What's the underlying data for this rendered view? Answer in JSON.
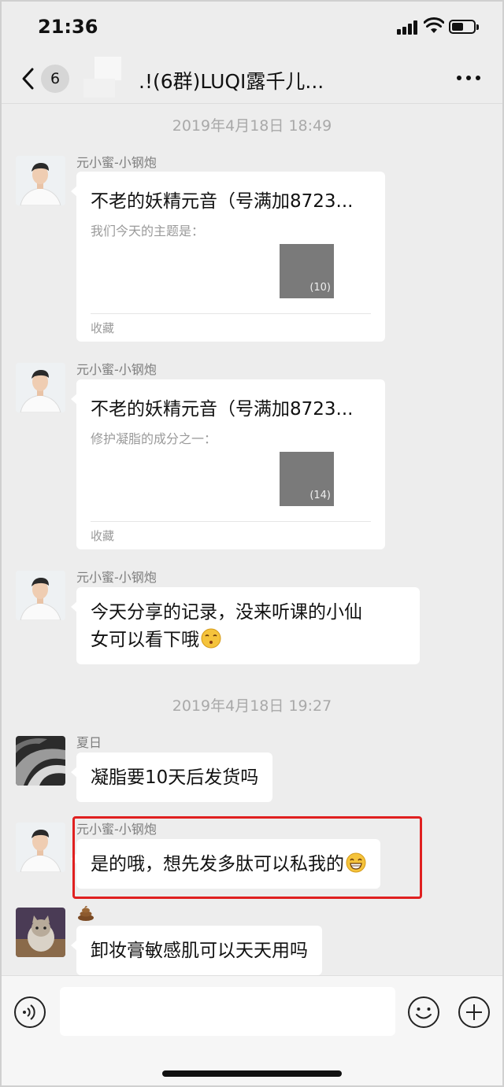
{
  "status_bar": {
    "time": "21:36"
  },
  "nav": {
    "unread_count": "6",
    "title": ".!(6群)LUQI露千儿..."
  },
  "timestamps": [
    "2019年4月18日 18:49",
    "2019年4月18日 19:27"
  ],
  "messages": [
    {
      "sender": "元小蜜-小钢炮",
      "type": "card",
      "title": "不老的妖精元音（号满加8723...",
      "subtitle": "我们今天的主题是：",
      "thumb_count": "(10)",
      "footer": "收藏"
    },
    {
      "sender": "元小蜜-小钢炮",
      "type": "card",
      "title": "不老的妖精元音（号满加8723...",
      "subtitle": "修护凝脂的成分之一：",
      "thumb_count": "(14)",
      "footer": "收藏"
    },
    {
      "sender": "元小蜜-小钢炮",
      "type": "text",
      "text_line1": "今天分享的记录，没来听课的小仙",
      "text_line2": "女可以看下哦",
      "emoji": "kissing-face-icon"
    },
    {
      "sender": "夏日",
      "type": "text",
      "text": "凝脂要10天后发货吗"
    },
    {
      "sender": "元小蜜-小钢炮",
      "type": "text",
      "text": "是的哦，想先发多肽可以私我的",
      "emoji": "grinning-face-icon",
      "highlighted": true,
      "highlight_color": "#e02020"
    },
    {
      "sender": "",
      "sender_icon": "poop-emoji-icon",
      "type": "text",
      "text": "卸妆膏敏感肌可以天天用吗"
    }
  ],
  "input": {
    "placeholder": "",
    "value": ""
  },
  "colors": {
    "background": "#ededed",
    "bubble": "#ffffff",
    "highlight": "#e02020",
    "timestamp": "#a9a9a9"
  }
}
